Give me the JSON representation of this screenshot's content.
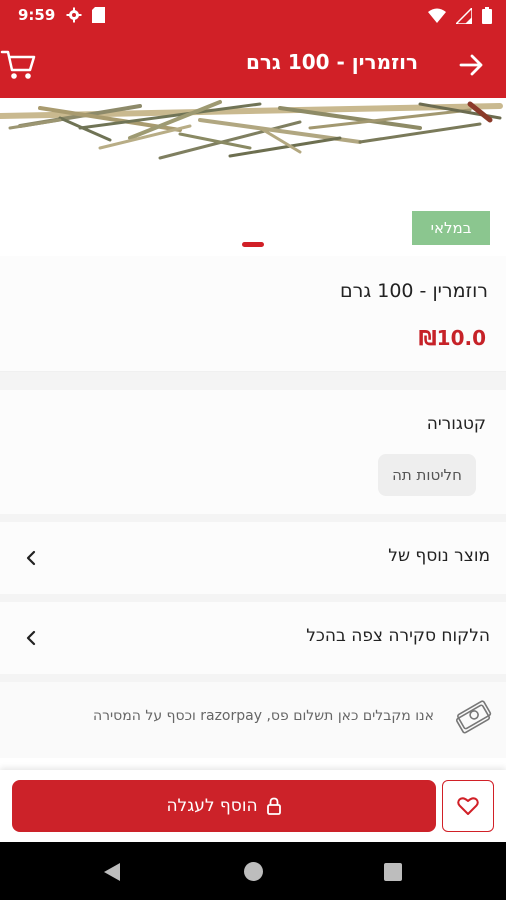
{
  "status_bar": {
    "time": "9:59"
  },
  "app_bar": {
    "title": "רוזמרין - 100 גרם"
  },
  "product": {
    "stock_badge": "במלאי",
    "name": "רוזמרין - 100 גרם",
    "price": "₪10.0"
  },
  "category": {
    "title": "קטגוריה",
    "chip": "חליטות תה"
  },
  "sections": [
    {
      "label": "מוצר נוסף של"
    },
    {
      "label": "הלקוח סקירה צפה בהכל"
    }
  ],
  "payment_note": "אנו מקבלים כאן תשלום פס, razorpay וכסף על המסירה",
  "bottom_bar": {
    "add_to_cart_label": "הוסף לעגלה"
  },
  "icons": {
    "back": "arrow-right-icon",
    "cart": "shopping-cart-icon",
    "chevron": "chevron-left-icon",
    "payment": "money-icon",
    "lock": "lock-icon",
    "heart": "heart-icon"
  },
  "colors": {
    "brand_red": "#d12027",
    "stock_green": "#8bc68f",
    "price_red": "#c62228"
  }
}
